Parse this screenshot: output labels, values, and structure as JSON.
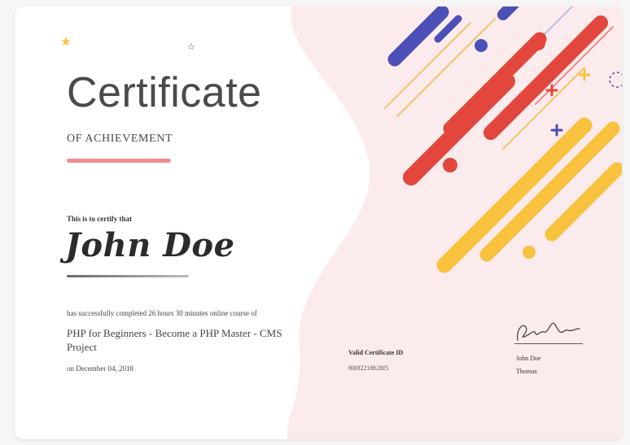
{
  "certificate": {
    "title": "Certificate",
    "subtitle": "OF ACHIEVEMENT",
    "certify_text": "This is to certify that",
    "recipient_name": "John Doe",
    "completed_text": "has successfully completed 26 hours 30 minutes online course of",
    "course_title": "PHP for Beginners - Become a PHP Master - CMS Project",
    "date_text": "on December 04, 2018",
    "certificate_id_label": "Valid Certificate ID",
    "certificate_id_value": "800f2218b28f5",
    "signer_name": "John Doe",
    "signer_title": "Thomas"
  },
  "colors": {
    "background_pink": "#fcebec",
    "accent_line": "#f28b8b",
    "stripe_blue": "#4b4fb8",
    "stripe_red": "#e2463c",
    "stripe_yellow": "#f8c23f",
    "outline_yellow": "#f3c56b",
    "outline_red": "#ef8b88",
    "star_yellow": "#f8c23f",
    "star_navy": "#3d3f8f"
  },
  "icons": {
    "star_filled": "★",
    "star_outline": "☆",
    "plus": "+"
  }
}
